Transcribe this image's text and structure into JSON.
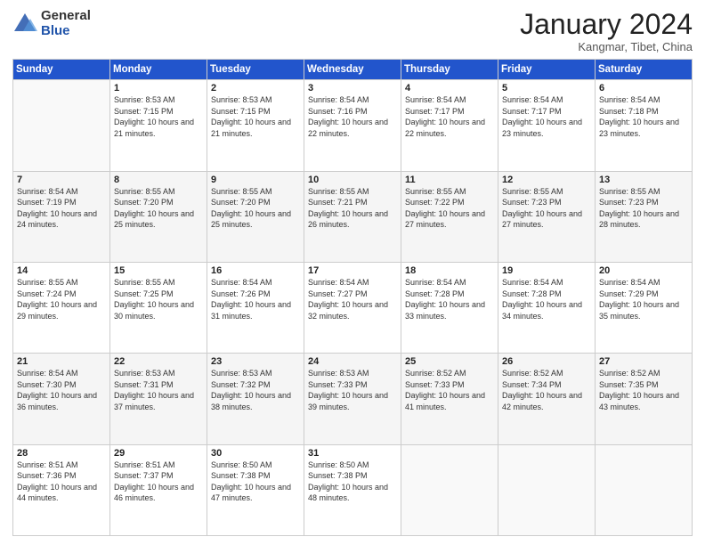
{
  "logo": {
    "general": "General",
    "blue": "Blue"
  },
  "header": {
    "title": "January 2024",
    "subtitle": "Kangmar, Tibet, China"
  },
  "days_of_week": [
    "Sunday",
    "Monday",
    "Tuesday",
    "Wednesday",
    "Thursday",
    "Friday",
    "Saturday"
  ],
  "weeks": [
    [
      {
        "num": "",
        "empty": true
      },
      {
        "num": "1",
        "sunrise": "Sunrise: 8:53 AM",
        "sunset": "Sunset: 7:15 PM",
        "daylight": "Daylight: 10 hours and 21 minutes."
      },
      {
        "num": "2",
        "sunrise": "Sunrise: 8:53 AM",
        "sunset": "Sunset: 7:15 PM",
        "daylight": "Daylight: 10 hours and 21 minutes."
      },
      {
        "num": "3",
        "sunrise": "Sunrise: 8:54 AM",
        "sunset": "Sunset: 7:16 PM",
        "daylight": "Daylight: 10 hours and 22 minutes."
      },
      {
        "num": "4",
        "sunrise": "Sunrise: 8:54 AM",
        "sunset": "Sunset: 7:17 PM",
        "daylight": "Daylight: 10 hours and 22 minutes."
      },
      {
        "num": "5",
        "sunrise": "Sunrise: 8:54 AM",
        "sunset": "Sunset: 7:17 PM",
        "daylight": "Daylight: 10 hours and 23 minutes."
      },
      {
        "num": "6",
        "sunrise": "Sunrise: 8:54 AM",
        "sunset": "Sunset: 7:18 PM",
        "daylight": "Daylight: 10 hours and 23 minutes."
      }
    ],
    [
      {
        "num": "7",
        "sunrise": "Sunrise: 8:54 AM",
        "sunset": "Sunset: 7:19 PM",
        "daylight": "Daylight: 10 hours and 24 minutes."
      },
      {
        "num": "8",
        "sunrise": "Sunrise: 8:55 AM",
        "sunset": "Sunset: 7:20 PM",
        "daylight": "Daylight: 10 hours and 25 minutes."
      },
      {
        "num": "9",
        "sunrise": "Sunrise: 8:55 AM",
        "sunset": "Sunset: 7:20 PM",
        "daylight": "Daylight: 10 hours and 25 minutes."
      },
      {
        "num": "10",
        "sunrise": "Sunrise: 8:55 AM",
        "sunset": "Sunset: 7:21 PM",
        "daylight": "Daylight: 10 hours and 26 minutes."
      },
      {
        "num": "11",
        "sunrise": "Sunrise: 8:55 AM",
        "sunset": "Sunset: 7:22 PM",
        "daylight": "Daylight: 10 hours and 27 minutes."
      },
      {
        "num": "12",
        "sunrise": "Sunrise: 8:55 AM",
        "sunset": "Sunset: 7:23 PM",
        "daylight": "Daylight: 10 hours and 27 minutes."
      },
      {
        "num": "13",
        "sunrise": "Sunrise: 8:55 AM",
        "sunset": "Sunset: 7:23 PM",
        "daylight": "Daylight: 10 hours and 28 minutes."
      }
    ],
    [
      {
        "num": "14",
        "sunrise": "Sunrise: 8:55 AM",
        "sunset": "Sunset: 7:24 PM",
        "daylight": "Daylight: 10 hours and 29 minutes."
      },
      {
        "num": "15",
        "sunrise": "Sunrise: 8:55 AM",
        "sunset": "Sunset: 7:25 PM",
        "daylight": "Daylight: 10 hours and 30 minutes."
      },
      {
        "num": "16",
        "sunrise": "Sunrise: 8:54 AM",
        "sunset": "Sunset: 7:26 PM",
        "daylight": "Daylight: 10 hours and 31 minutes."
      },
      {
        "num": "17",
        "sunrise": "Sunrise: 8:54 AM",
        "sunset": "Sunset: 7:27 PM",
        "daylight": "Daylight: 10 hours and 32 minutes."
      },
      {
        "num": "18",
        "sunrise": "Sunrise: 8:54 AM",
        "sunset": "Sunset: 7:28 PM",
        "daylight": "Daylight: 10 hours and 33 minutes."
      },
      {
        "num": "19",
        "sunrise": "Sunrise: 8:54 AM",
        "sunset": "Sunset: 7:28 PM",
        "daylight": "Daylight: 10 hours and 34 minutes."
      },
      {
        "num": "20",
        "sunrise": "Sunrise: 8:54 AM",
        "sunset": "Sunset: 7:29 PM",
        "daylight": "Daylight: 10 hours and 35 minutes."
      }
    ],
    [
      {
        "num": "21",
        "sunrise": "Sunrise: 8:54 AM",
        "sunset": "Sunset: 7:30 PM",
        "daylight": "Daylight: 10 hours and 36 minutes."
      },
      {
        "num": "22",
        "sunrise": "Sunrise: 8:53 AM",
        "sunset": "Sunset: 7:31 PM",
        "daylight": "Daylight: 10 hours and 37 minutes."
      },
      {
        "num": "23",
        "sunrise": "Sunrise: 8:53 AM",
        "sunset": "Sunset: 7:32 PM",
        "daylight": "Daylight: 10 hours and 38 minutes."
      },
      {
        "num": "24",
        "sunrise": "Sunrise: 8:53 AM",
        "sunset": "Sunset: 7:33 PM",
        "daylight": "Daylight: 10 hours and 39 minutes."
      },
      {
        "num": "25",
        "sunrise": "Sunrise: 8:52 AM",
        "sunset": "Sunset: 7:33 PM",
        "daylight": "Daylight: 10 hours and 41 minutes."
      },
      {
        "num": "26",
        "sunrise": "Sunrise: 8:52 AM",
        "sunset": "Sunset: 7:34 PM",
        "daylight": "Daylight: 10 hours and 42 minutes."
      },
      {
        "num": "27",
        "sunrise": "Sunrise: 8:52 AM",
        "sunset": "Sunset: 7:35 PM",
        "daylight": "Daylight: 10 hours and 43 minutes."
      }
    ],
    [
      {
        "num": "28",
        "sunrise": "Sunrise: 8:51 AM",
        "sunset": "Sunset: 7:36 PM",
        "daylight": "Daylight: 10 hours and 44 minutes."
      },
      {
        "num": "29",
        "sunrise": "Sunrise: 8:51 AM",
        "sunset": "Sunset: 7:37 PM",
        "daylight": "Daylight: 10 hours and 46 minutes."
      },
      {
        "num": "30",
        "sunrise": "Sunrise: 8:50 AM",
        "sunset": "Sunset: 7:38 PM",
        "daylight": "Daylight: 10 hours and 47 minutes."
      },
      {
        "num": "31",
        "sunrise": "Sunrise: 8:50 AM",
        "sunset": "Sunset: 7:38 PM",
        "daylight": "Daylight: 10 hours and 48 minutes."
      },
      {
        "num": "",
        "empty": true
      },
      {
        "num": "",
        "empty": true
      },
      {
        "num": "",
        "empty": true
      }
    ]
  ]
}
